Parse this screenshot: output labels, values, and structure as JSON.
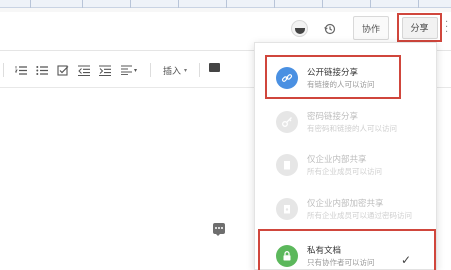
{
  "header": {
    "history_icon": "history-icon",
    "collab_label": "协作",
    "share_label": "分享"
  },
  "toolbar": {
    "insert_label": "插入",
    "insert_caret": "▾",
    "align_caret": "▾"
  },
  "share_menu": {
    "options": [
      {
        "title": "公开链接分享",
        "desc": "有链接的人可以访问",
        "icon": "link-icon",
        "state": "active",
        "highlighted": true
      },
      {
        "title": "密码链接分享",
        "desc": "有密码和链接的人可以访问",
        "icon": "key-icon",
        "state": "disabled"
      },
      {
        "title": "仅企业内部共享",
        "desc": "所有企业成员可以访问",
        "icon": "building-icon",
        "state": "disabled"
      },
      {
        "title": "仅企业内部加密共享",
        "desc": "所有企业成员可以通过密码访问",
        "icon": "lock-building-icon",
        "state": "disabled"
      },
      {
        "title": "私有文档",
        "desc": "只有协作者可以访问",
        "icon": "lock-icon",
        "state": "active",
        "selected": true,
        "highlighted": true
      }
    ],
    "selected_mark": "✓"
  },
  "colors": {
    "highlight_red": "#d0463c",
    "link_blue": "#4a90e2",
    "private_green": "#5cb85c"
  }
}
